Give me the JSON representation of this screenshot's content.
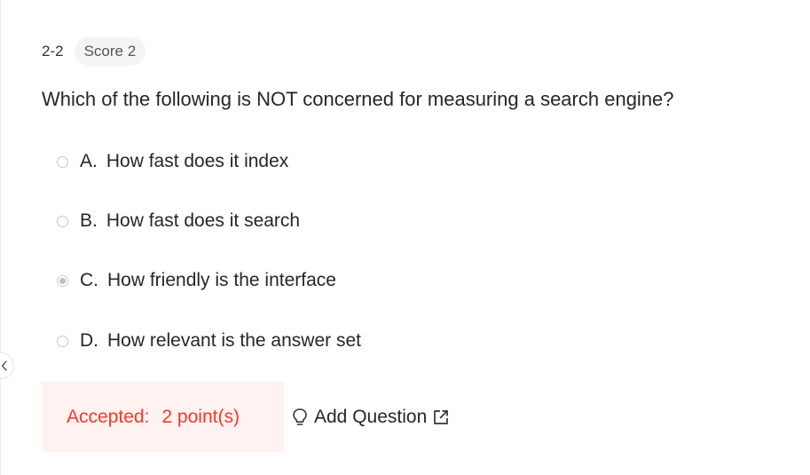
{
  "question": {
    "number": "2-2",
    "score_label": "Score 2",
    "text": "Which of the following is NOT concerned for measuring a search engine?",
    "options": [
      {
        "letter": "A.",
        "text": "How fast does it index",
        "selected": false
      },
      {
        "letter": "B.",
        "text": "How fast does it search",
        "selected": false
      },
      {
        "letter": "C.",
        "text": "How friendly is the interface",
        "selected": true
      },
      {
        "letter": "D.",
        "text": "How relevant is the answer set",
        "selected": false
      }
    ]
  },
  "result": {
    "label": "Accepted:",
    "points": "2 point(s)"
  },
  "actions": {
    "add_question_label": "Add Question"
  },
  "icons": {
    "collapse": "chevron-left-icon",
    "add_question": "lightbulb-icon",
    "external": "external-link-icon"
  },
  "colors": {
    "accent_red": "#f5392b",
    "result_bg": "#fff2f0",
    "badge_bg": "#f4f4f5"
  }
}
